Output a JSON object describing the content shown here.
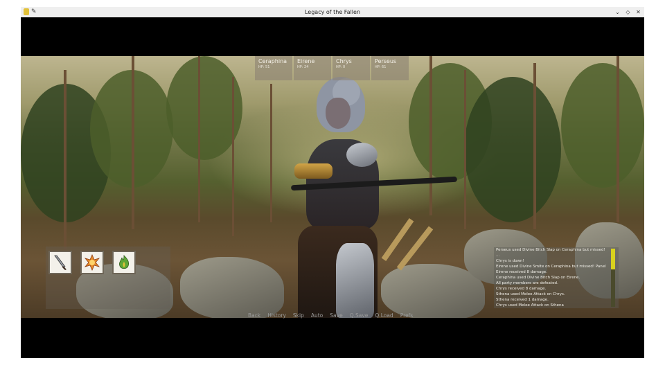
{
  "window": {
    "title": "Legacy of the Fallen"
  },
  "party": [
    {
      "name": "Ceraphina",
      "hp": "HP: 51"
    },
    {
      "name": "Eirene",
      "hp": "HP: 24"
    },
    {
      "name": "Chrys",
      "hp": "HP: 0"
    },
    {
      "name": "Perseus",
      "hp": "HP: 61"
    }
  ],
  "skills": [
    {
      "icon": "dagger-icon"
    },
    {
      "icon": "fire-crest-icon"
    },
    {
      "icon": "green-flame-icon"
    }
  ],
  "battle_log": [
    "Perseus used Divine Bitch Slap on Ceraphina but missed!",
    "...",
    "Chrys is down!",
    "Eirene used Divine Smite on Ceraphina but missed! Panel",
    "Eirene received 8 damage.",
    "Ceraphina used Divine Bitch Slap on Eirene.",
    "All party members are defeated.",
    "Chrys received 8 damage.",
    "Sthena used Melee Attack on Chrys.",
    "Sthena received 1 damage.",
    "Chrys used Melee Attack on Sthena"
  ],
  "quick_menu": [
    "Back",
    "History",
    "Skip",
    "Auto",
    "Save",
    "Q.Save",
    "Q.Load",
    "Prefs"
  ],
  "colors": {
    "scrollbar_thumb": "#d8d21e",
    "panel": "#8c8273"
  }
}
